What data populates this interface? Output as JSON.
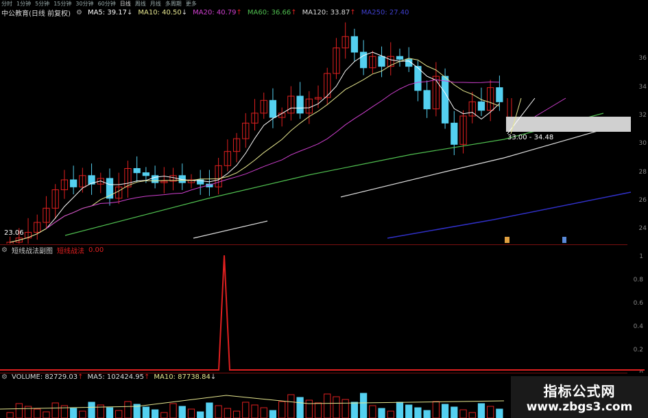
{
  "toolbar": {
    "items": [
      "分时",
      "1分钟",
      "5分钟",
      "15分钟",
      "30分钟",
      "60分钟",
      "日线",
      "周线",
      "月线",
      "多周期",
      "更多"
    ],
    "active_index": 6
  },
  "stock": {
    "name_label": "中公教育(日线 前复权)"
  },
  "ma_lines": [
    {
      "label": "MA5: 39.17",
      "arrow": "↓",
      "color": "#ffffff"
    },
    {
      "label": "MA10: 40.50",
      "arrow": "↓",
      "color": "#e8e890"
    },
    {
      "label": "MA20: 40.79",
      "arrow": "↑",
      "color": "#d040d0"
    },
    {
      "label": "MA60: 36.66",
      "arrow": "↑",
      "color": "#50c050"
    },
    {
      "label": "MA120: 33.87",
      "arrow": "↑",
      "color": "#dddddd"
    },
    {
      "label": "MA250: 27.40",
      "arrow": "",
      "color": "#4040d0"
    }
  ],
  "price_axis": [
    "36",
    "34",
    "32",
    "30",
    "28",
    "26",
    "24"
  ],
  "range_label": "33.00 - 34.48",
  "low_label": "23.06",
  "indicator": {
    "title": "短线战法副图",
    "name": "短线战法",
    "value": "0.00",
    "axis": [
      "1",
      "0.8",
      "0.6",
      "0.4",
      "0.2",
      "0"
    ]
  },
  "volume": {
    "label": "VOLUME: 82729.03",
    "arrow1": "↑",
    "ma5": "MA5: 102424.95",
    "arrow2": "↑",
    "ma10": "MA10: 87738.84",
    "arrow3": "↓"
  },
  "watermark": {
    "title": "指标公式网",
    "url": "www.zbgs3.com"
  },
  "chart_data": {
    "type": "candlestick",
    "close_series": [
      23.1,
      23.4,
      23.8,
      24.5,
      25.5,
      26.8,
      27.5,
      27.0,
      27.8,
      27.2,
      27.6,
      26.2,
      27.0,
      28.3,
      28.0,
      27.8,
      27.3,
      27.4,
      27.8,
      27.3,
      27.5,
      27.2,
      27.0,
      28.5,
      29.5,
      30.4,
      31.5,
      32.2,
      33.1,
      31.9,
      32.2,
      33.4,
      32.2,
      33.2,
      33.3,
      35.0,
      36.8,
      37.6,
      36.5,
      35.4,
      36.2,
      35.5,
      36.2,
      36.0,
      35.5,
      33.8,
      32.5,
      34.8,
      31.5,
      30.0,
      32.0,
      33.0,
      32.4,
      34.0,
      33.0
    ],
    "ylim": [
      23,
      38
    ]
  }
}
